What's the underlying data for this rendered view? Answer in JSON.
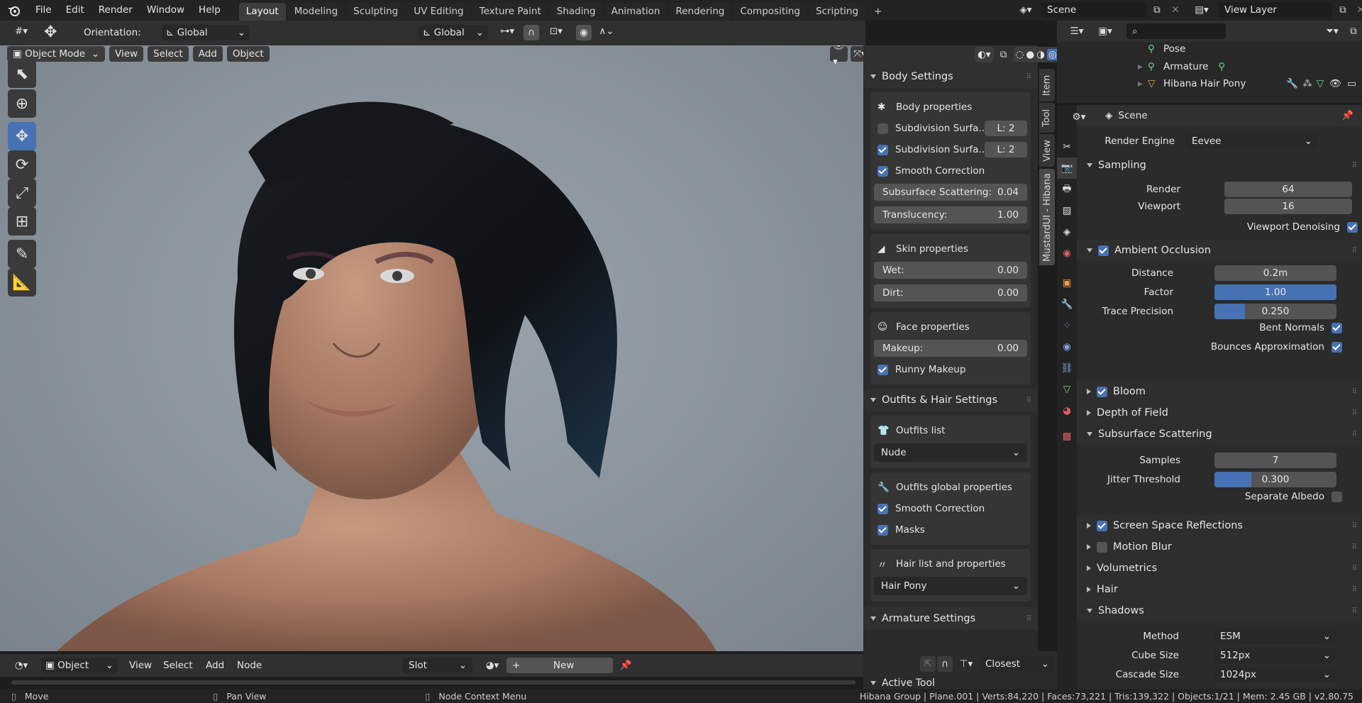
{
  "topbar": {
    "menus": [
      "File",
      "Edit",
      "Render",
      "Window",
      "Help"
    ],
    "workspaces": [
      "Layout",
      "Modeling",
      "Sculpting",
      "UV Editing",
      "Texture Paint",
      "Shading",
      "Animation",
      "Rendering",
      "Compositing",
      "Scripting"
    ],
    "active_workspace": "Layout",
    "scene": "Scene",
    "view_layer": "View Layer"
  },
  "tool_header": {
    "orientation_label": "Orientation:",
    "orientation_value": "Global",
    "transform_orientation": "Global"
  },
  "viewport_header": {
    "mode": "Object Mode",
    "menus": [
      "View",
      "Select",
      "Add",
      "Object"
    ]
  },
  "npanel": {
    "tabs": [
      "Item",
      "Tool",
      "View",
      "MustardUI - Hibana"
    ],
    "body_settings": {
      "title": "Body Settings",
      "body_properties": "Body properties",
      "subdiv1_label": "Subdivision Surfa..",
      "subdiv1_level": "L: 2",
      "subdiv1_checked": false,
      "subdiv2_label": "Subdivision Surfa..",
      "subdiv2_level": "L: 2",
      "subdiv2_checked": true,
      "smooth_correction": "Smooth Correction",
      "sss_label": "Subsurface Scattering:",
      "sss_value": "0.04",
      "translucency_label": "Translucency:",
      "translucency_value": "1.00",
      "skin_properties": "Skin properties",
      "wet_label": "Wet:",
      "wet_value": "0.00",
      "dirt_label": "Dirt:",
      "dirt_value": "0.00",
      "face_properties": "Face properties",
      "makeup_label": "Makeup:",
      "makeup_value": "0.00",
      "runny_makeup": "Runny Makeup"
    },
    "outfits": {
      "title": "Outfits & Hair Settings",
      "outfits_list": "Outfits list",
      "outfit_selected": "Nude",
      "global_props": "Outfits global properties",
      "smooth_correction": "Smooth Correction",
      "masks": "Masks",
      "hair_list": "Hair list and properties",
      "hair_selected": "Hair Pony"
    },
    "armature_title": "Armature Settings",
    "active_tool_title": "Active Tool"
  },
  "outliner": {
    "items": [
      {
        "label": "Pose"
      },
      {
        "label": "Armature"
      },
      {
        "label": "Hibana Hair Pony"
      }
    ]
  },
  "properties": {
    "context": "Scene",
    "render_engine_label": "Render Engine",
    "render_engine": "Eevee",
    "sampling": {
      "title": "Sampling",
      "render_label": "Render",
      "render": "64",
      "viewport_label": "Viewport",
      "viewport": "16",
      "denoise": "Viewport Denoising"
    },
    "ao": {
      "title": "Ambient Occlusion",
      "distance_label": "Distance",
      "distance": "0.2m",
      "factor_label": "Factor",
      "factor": "1.00",
      "factor_fill": 1.0,
      "trace_label": "Trace Precision",
      "trace": "0.250",
      "trace_fill": 0.25,
      "bent_normals": "Bent Normals",
      "bounces": "Bounces Approximation"
    },
    "bloom": "Bloom",
    "dof": "Depth of Field",
    "sss": {
      "title": "Subsurface Scattering",
      "samples_label": "Samples",
      "samples": "7",
      "jitter_label": "Jitter Threshold",
      "jitter": "0.300",
      "jitter_fill": 0.3,
      "separate_albedo": "Separate Albedo"
    },
    "ssr": "Screen Space Reflections",
    "motion_blur": "Motion Blur",
    "volumetrics": "Volumetrics",
    "hair": "Hair",
    "shadows": {
      "title": "Shadows",
      "method_label": "Method",
      "method": "ESM",
      "cube_label": "Cube Size",
      "cube": "512px",
      "cascade_label": "Cascade Size",
      "cascade": "1024px"
    }
  },
  "bottom_header": {
    "object": "Object",
    "menus": [
      "View",
      "Select",
      "Add",
      "Node"
    ],
    "slot": "Slot",
    "new": "New",
    "interpolation": "Closest"
  },
  "status": {
    "move": "Move",
    "pan": "Pan View",
    "context": "Node Context Menu",
    "stats": "Hibana Group | Plane.001 | Verts:84,220 | Faces:73,221 | Tris:139,322 | Objects:1/21 | Mem: 2.45 GB | v2.80.75"
  },
  "colors": {
    "accent": "#4772b3",
    "bg": "#2b2b2b"
  }
}
